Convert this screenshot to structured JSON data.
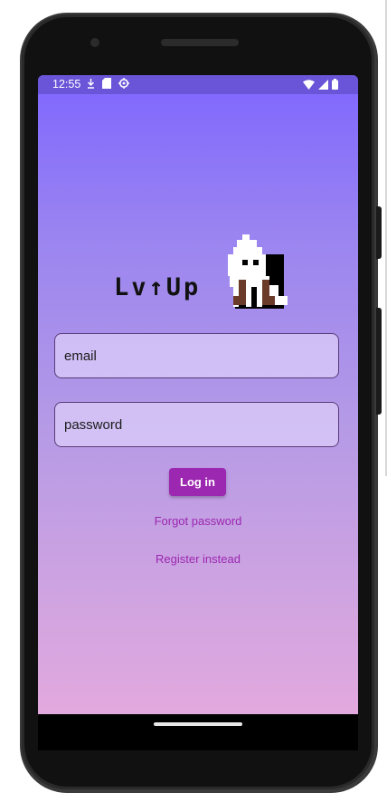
{
  "status_bar": {
    "time": "12:55",
    "left_icons": [
      "download-icon",
      "sd-card-icon",
      "settings-gear-icon"
    ],
    "right_icons": [
      "wifi-icon",
      "signal-icon",
      "battery-icon"
    ]
  },
  "logo": {
    "text": "Lv↑Up",
    "mascot": "ghost-mascot-icon"
  },
  "form": {
    "email_placeholder": "email",
    "password_placeholder": "password",
    "login_label": "Log in",
    "forgot_label": "Forgot password",
    "register_label": "Register instead"
  },
  "colors": {
    "accent": "#9c27b0",
    "status_bar": "#6a55d8",
    "gradient_top": "#7f66ff",
    "gradient_bottom": "#e2a9de"
  }
}
